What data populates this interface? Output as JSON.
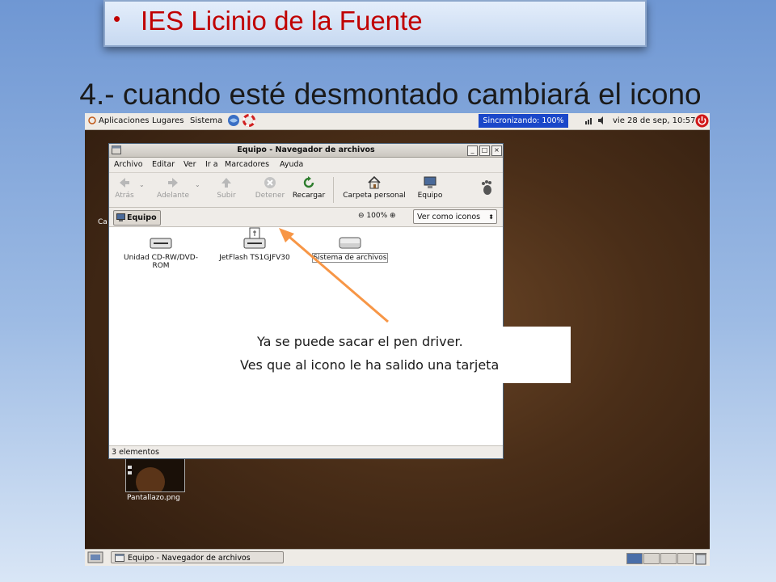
{
  "slide": {
    "header_bullet": "•",
    "header_title": "IES Licinio de la Fuente",
    "subtitle": "4.- cuando esté desmontado cambiará el icono"
  },
  "top_panel": {
    "menus": [
      "Aplicaciones",
      "Lugares",
      "Sistema"
    ],
    "sync_status": "Sincronizando: 100%",
    "clock": "vie 28 de sep, 10:57"
  },
  "desktop": {
    "partial_label": "Ca",
    "file_label": "Pantallazo.png"
  },
  "window": {
    "title": "Equipo - Navegador de archivos",
    "menu": [
      "Archivo",
      "Editar",
      "Ver",
      "Ir a",
      "Marcadores",
      "Ayuda"
    ],
    "toolbar": {
      "back": "Atrás",
      "forward": "Adelante",
      "up": "Subir",
      "stop": "Detener",
      "reload": "Recargar",
      "home": "Carpeta personal",
      "computer": "Equipo"
    },
    "location_button": "Equipo",
    "zoom_level": "100%",
    "view_mode": "Ver como iconos",
    "items": [
      {
        "label_line1": "Unidad CD-RW/DVD-",
        "label_line2": "ROM",
        "icon": "cdrom-drive-icon"
      },
      {
        "label_line1": "JetFlash TS1GJFV30",
        "label_line2": "",
        "icon": "usb-drive-unmounted-icon"
      },
      {
        "label_line1": "Sistema de archivos",
        "label_line2": "",
        "icon": "hard-drive-icon"
      }
    ],
    "status": "3 elementos"
  },
  "taskbar": {
    "task_label": "Equipo - Navegador de archivos"
  },
  "callout": {
    "line1": "Ya se puede sacar el pen driver.",
    "line2": "Ves que al icono le ha salido una tarjeta"
  },
  "colors": {
    "title_red": "#c00000",
    "sync_blue": "#1a47c9",
    "arrow_orange": "#f79646"
  }
}
